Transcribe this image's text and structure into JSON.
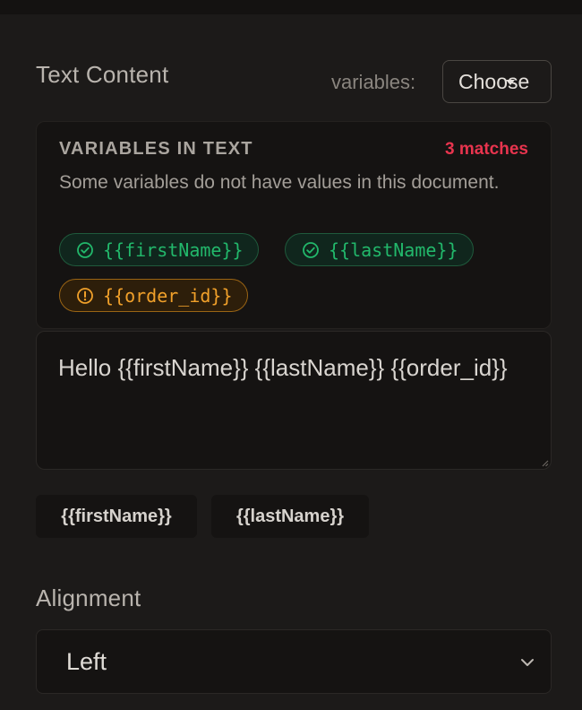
{
  "text_content": {
    "title": "Text Content",
    "variables_label": "variables:",
    "choose_value": "Choose"
  },
  "variables_panel": {
    "heading": "VARIABLES IN TEXT",
    "matches": "3 matches",
    "warning": "Some variables do not have values in this document.",
    "chips": [
      {
        "label": "{{firstName}}",
        "status": "ok",
        "icon": "check-circle-icon"
      },
      {
        "label": "{{lastName}}",
        "status": "ok",
        "icon": "check-circle-icon"
      },
      {
        "label": "{{order_id}}",
        "status": "missing",
        "icon": "alert-circle-icon"
      }
    ]
  },
  "editor": {
    "value": "Hello {{firstName}} {{lastName}} {{order_id}}"
  },
  "insert_buttons": [
    {
      "label": "{{firstName}}"
    },
    {
      "label": "{{lastName}}"
    }
  ],
  "alignment": {
    "title": "Alignment",
    "value": "Left"
  },
  "colors": {
    "ok": "#22b86b",
    "warning": "#f0a02a",
    "error": "#e8344e",
    "background": "#1c1a19"
  }
}
